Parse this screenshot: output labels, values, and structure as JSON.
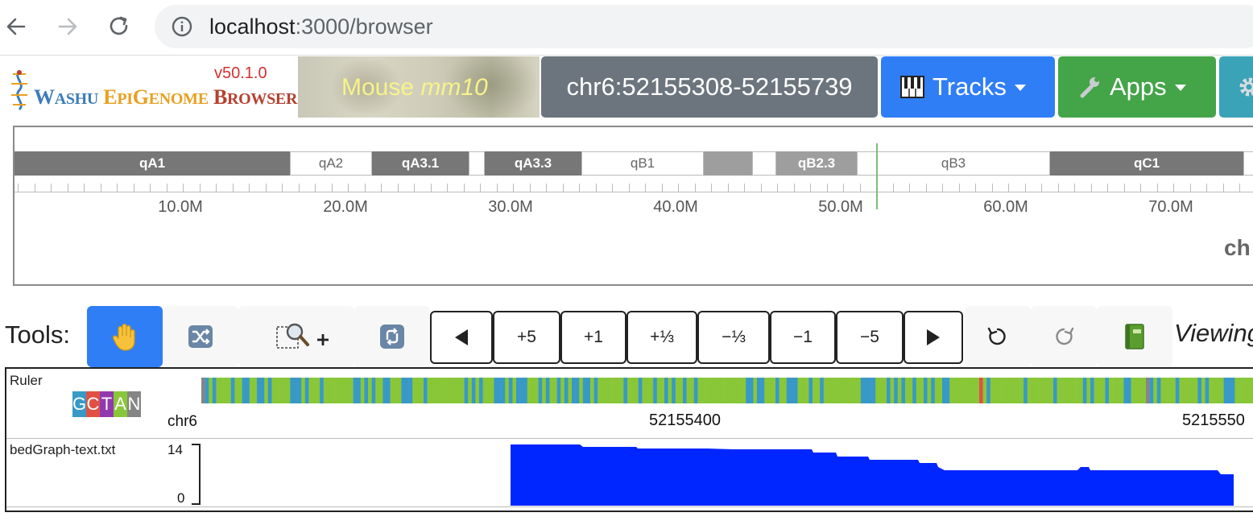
{
  "browser": {
    "url_host": "localhost",
    "url_rest": ":3000/browser"
  },
  "header": {
    "logo_line": {
      "w1": "W",
      "w2": "ASHU",
      "e1": "E",
      "e2": "PI",
      "g1": "G",
      "g2": "ENOME",
      "b1": "B",
      "b2": "ROWSER"
    },
    "version": "v50.1.0",
    "genome_prefix": "Mouse",
    "genome_name": "mm10",
    "region": "chr6:52155308-52155739",
    "tracks_label": "Tracks",
    "apps_label": "Apps"
  },
  "ideogram": {
    "bands": [
      "qA1",
      "qA2",
      "qA3.1",
      "qA3.3",
      "qB1",
      "qB2.3",
      "qB3",
      "qC1"
    ],
    "tick_labels": [
      "10.0M",
      "20.0M",
      "30.0M",
      "40.0M",
      "50.0M",
      "60.0M",
      "70.0M"
    ],
    "chr_label_partial": "ch"
  },
  "tools": {
    "label": "Tools:",
    "nav_buttons": [
      "+5",
      "+1",
      "+⅓",
      "−⅓",
      "−1",
      "−5"
    ],
    "viewing_label": "Viewing"
  },
  "tracks": {
    "ruler_name": "Ruler",
    "legend_letters": [
      "G",
      "C",
      "T",
      "A",
      "N"
    ],
    "legend_colors": [
      "#3899c7",
      "#e05144",
      "#9238af",
      "#89c738",
      "#858585"
    ],
    "chrom": "chr6",
    "coord_1": "52155400",
    "coord_2": "5215550",
    "bedgraph_name": "bedGraph-text.txt",
    "y_max": "14",
    "y_min": "0",
    "bar_color": "#0026ff"
  }
}
